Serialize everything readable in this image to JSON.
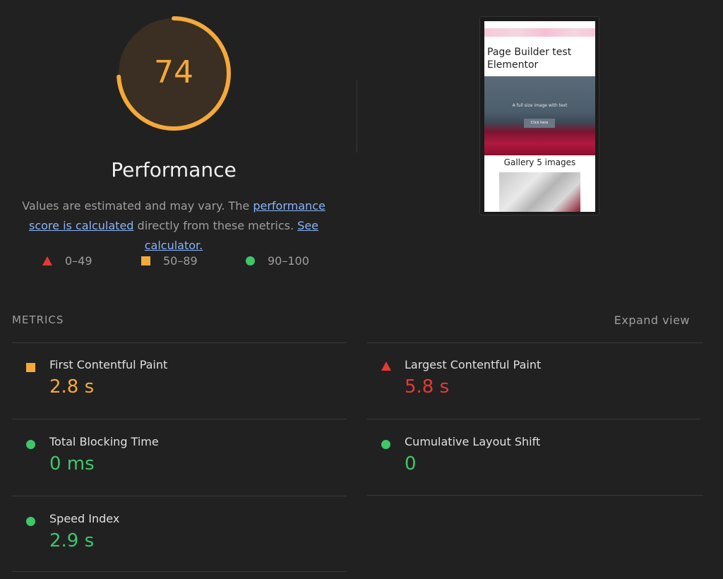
{
  "gauge": {
    "score": "74",
    "score_fraction": 0.74,
    "title": "Performance",
    "color": "#f4a93b"
  },
  "description": {
    "part1": "Values are estimated and may vary. The ",
    "link1": "performance score is calculated",
    "part2": " directly from these metrics. ",
    "link2": "See calculator."
  },
  "legend": [
    {
      "shape": "triangle",
      "range": "0–49",
      "color": "#e53935"
    },
    {
      "shape": "square",
      "range": "50–89",
      "color": "#f4a93b"
    },
    {
      "shape": "circle",
      "range": "90–100",
      "color": "#3ec66b"
    }
  ],
  "screenshot": {
    "page_title": "Page Builder test Elementor",
    "hero_text": "A full size image with text",
    "hero_button": "Click here",
    "gallery_title": "Gallery 5 images"
  },
  "metrics": {
    "heading": "METRICS",
    "expand_label": "Expand view",
    "items": [
      {
        "label": "First Contentful Paint",
        "value": "2.8 s",
        "status": "average"
      },
      {
        "label": "Largest Contentful Paint",
        "value": "5.8 s",
        "status": "fail"
      },
      {
        "label": "Total Blocking Time",
        "value": "0 ms",
        "status": "pass"
      },
      {
        "label": "Cumulative Layout Shift",
        "value": "0",
        "status": "pass"
      },
      {
        "label": "Speed Index",
        "value": "2.9 s",
        "status": "pass"
      }
    ]
  }
}
